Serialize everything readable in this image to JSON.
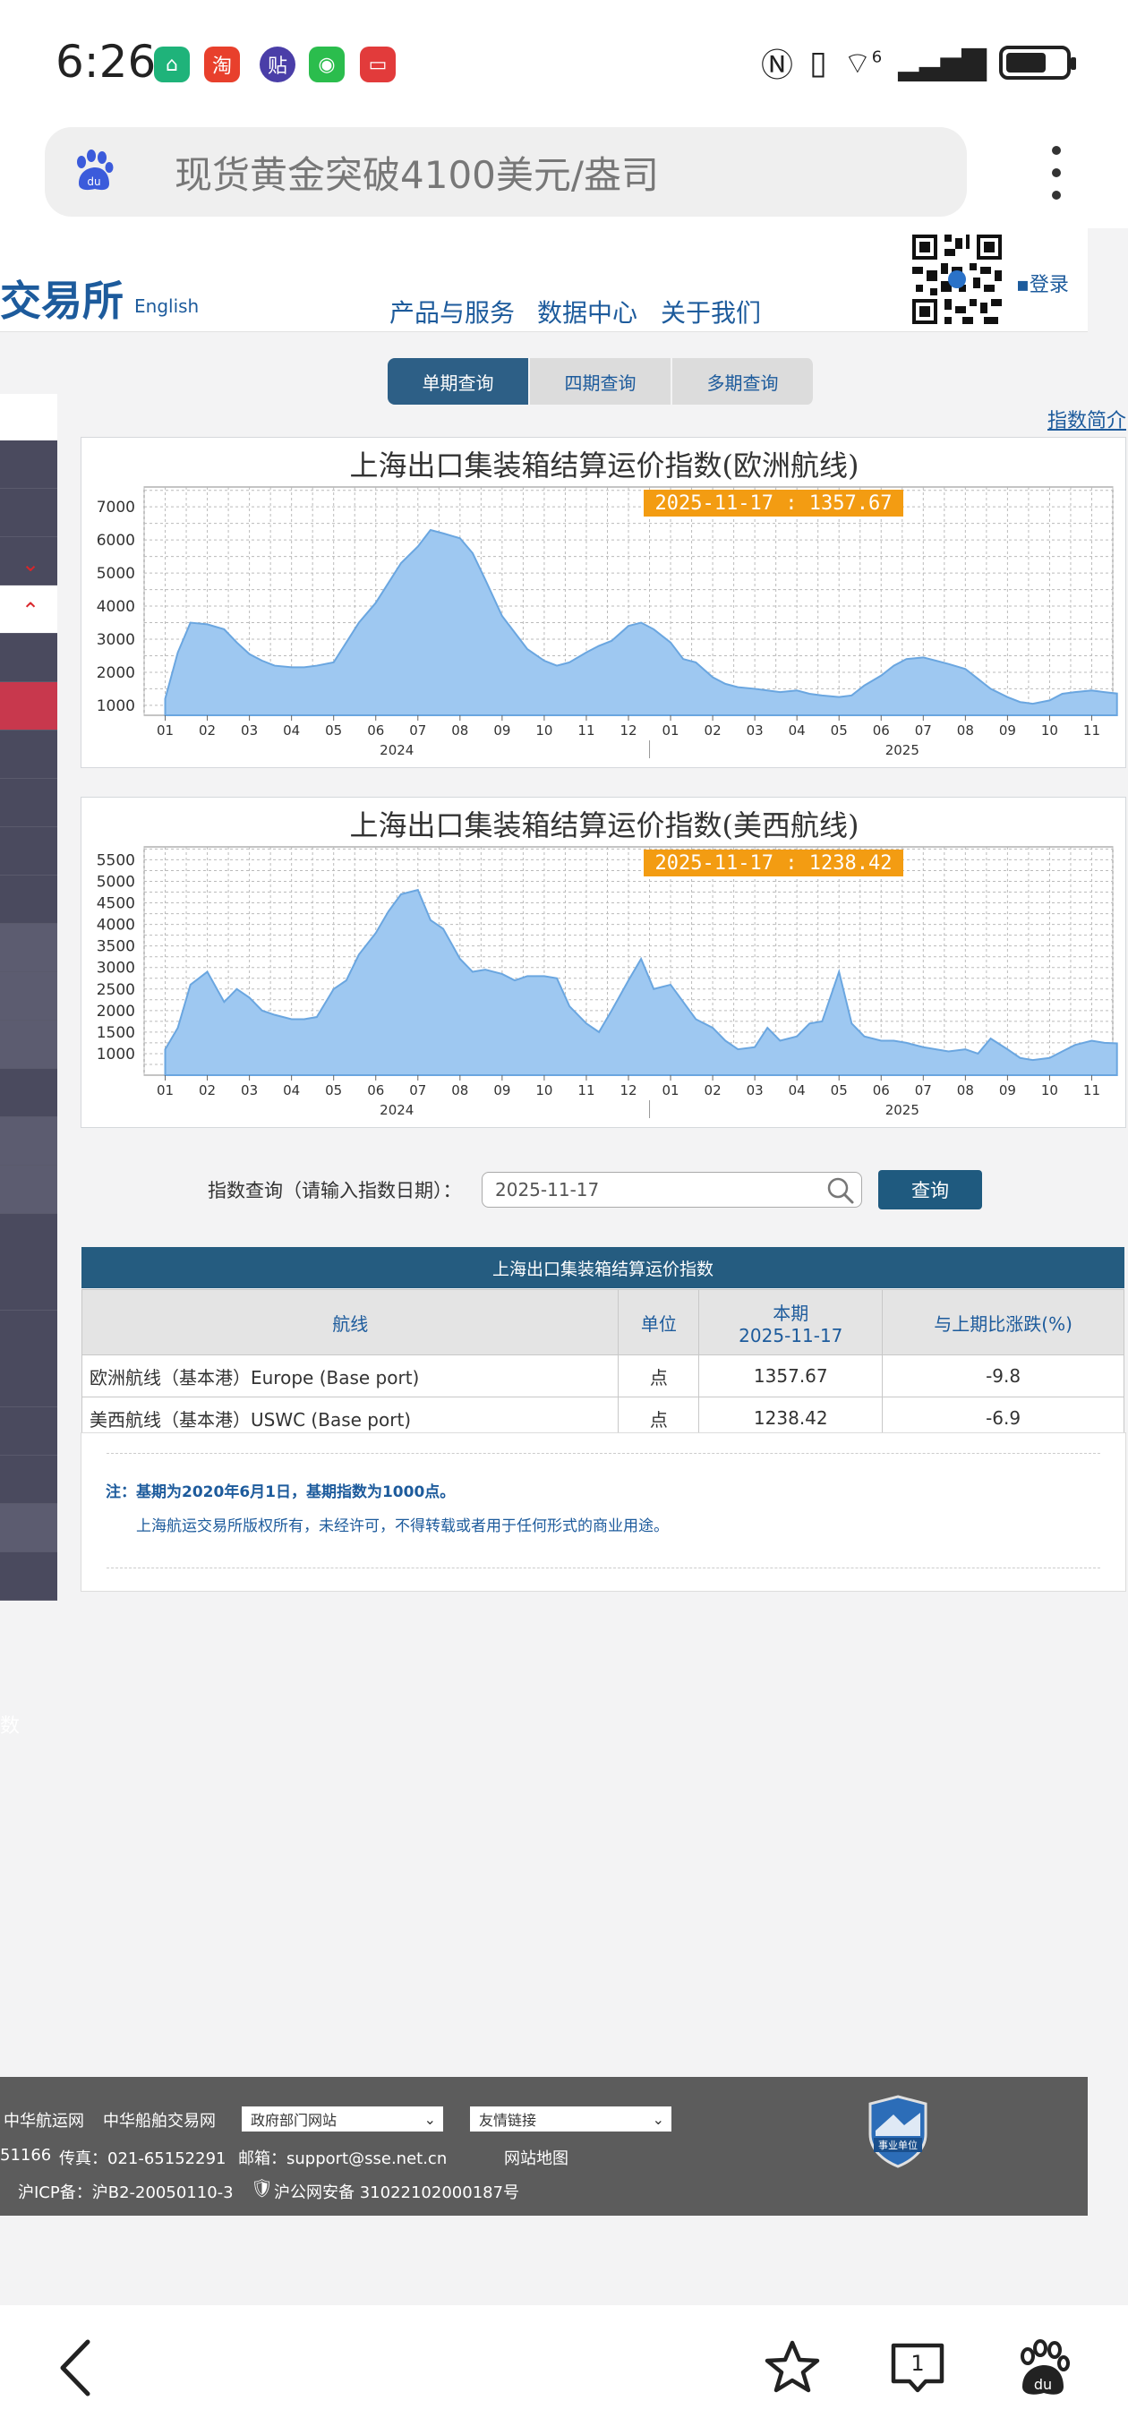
{
  "status": {
    "time": "6:26",
    "network": "6"
  },
  "browser": {
    "address": "现货黄金突破4100美元/盎司"
  },
  "site": {
    "logo_text": "交易所",
    "english": "English",
    "nav": [
      "产品与服务",
      "数据中心",
      "关于我们"
    ],
    "login": "▪登录"
  },
  "tabs": [
    "单期查询",
    "四期查询",
    "多期查询"
  ],
  "intro_link": "指数简介",
  "charts": [
    {
      "title": "上海出口集装箱结算运价指数(欧洲航线)",
      "tooltip": "2025-11-17 : 1357.67"
    },
    {
      "title": "上海出口集装箱结算运价指数(美西航线)",
      "tooltip": "2025-11-17 : 1238.42"
    }
  ],
  "chart_data": [
    {
      "type": "area",
      "title": "上海出口集装箱结算运价指数(欧洲航线)",
      "x_tick_labels": [
        "01",
        "02",
        "03",
        "04",
        "05",
        "06",
        "07",
        "08",
        "09",
        "10",
        "11",
        "12",
        "01",
        "02",
        "03",
        "04",
        "05",
        "06",
        "07",
        "08",
        "09",
        "10",
        "11"
      ],
      "year_labels": [
        "2024",
        "2025"
      ],
      "ylim": [
        700,
        7600
      ],
      "yticks": [
        1000,
        2000,
        3000,
        4000,
        5000,
        6000,
        7000
      ],
      "grid": true,
      "x_month_index": [
        0,
        0.3,
        0.6,
        1,
        1.4,
        1.7,
        2,
        2.3,
        2.6,
        3,
        3.3,
        3.6,
        4,
        4.3,
        4.6,
        5,
        5.3,
        5.6,
        6,
        6.3,
        6.6,
        7,
        7.3,
        7.6,
        8,
        8.3,
        8.6,
        9,
        9.3,
        9.6,
        10,
        10.3,
        10.6,
        11,
        11.3,
        11.6,
        12,
        12.3,
        12.6,
        13,
        13.3,
        13.6,
        14,
        14.3,
        14.6,
        15,
        15.3,
        15.6,
        16,
        16.3,
        16.6,
        17,
        17.3,
        17.6,
        18,
        18.3,
        18.6,
        19,
        19.3,
        19.6,
        20,
        20.3,
        20.6,
        21,
        21.3,
        21.6,
        22,
        22.3,
        22.6
      ],
      "values": [
        1200,
        2600,
        3500,
        3450,
        3300,
        2900,
        2550,
        2350,
        2200,
        2150,
        2150,
        2200,
        2300,
        2900,
        3500,
        4100,
        4700,
        5300,
        5800,
        6300,
        6200,
        6050,
        5600,
        4800,
        3700,
        3200,
        2700,
        2350,
        2200,
        2300,
        2600,
        2800,
        2950,
        3400,
        3500,
        3300,
        2900,
        2400,
        2300,
        1850,
        1650,
        1550,
        1500,
        1450,
        1400,
        1450,
        1350,
        1300,
        1250,
        1300,
        1600,
        1900,
        2200,
        2400,
        2450,
        2350,
        2250,
        2100,
        1800,
        1500,
        1250,
        1100,
        1050,
        1150,
        1350,
        1400,
        1450,
        1400,
        1357.67
      ]
    },
    {
      "type": "area",
      "title": "上海出口集装箱结算运价指数(美西航线)",
      "x_tick_labels": [
        "01",
        "02",
        "03",
        "04",
        "05",
        "06",
        "07",
        "08",
        "09",
        "10",
        "11",
        "12",
        "01",
        "02",
        "03",
        "04",
        "05",
        "06",
        "07",
        "08",
        "09",
        "10",
        "11"
      ],
      "year_labels": [
        "2024",
        "2025"
      ],
      "ylim": [
        500,
        5800
      ],
      "yticks": [
        1000,
        1500,
        2000,
        2500,
        3000,
        3500,
        4000,
        4500,
        5000,
        5500
      ],
      "grid": true,
      "x_month_index": [
        0,
        0.3,
        0.6,
        1,
        1.4,
        1.7,
        2,
        2.3,
        2.6,
        3,
        3.3,
        3.6,
        4,
        4.3,
        4.6,
        5,
        5.3,
        5.6,
        6,
        6.3,
        6.6,
        7,
        7.3,
        7.6,
        8,
        8.3,
        8.6,
        9,
        9.3,
        9.6,
        10,
        10.3,
        10.6,
        11,
        11.3,
        11.6,
        12,
        12.3,
        12.6,
        13,
        13.3,
        13.6,
        14,
        14.3,
        14.6,
        15,
        15.3,
        15.6,
        16,
        16.3,
        16.6,
        17,
        17.3,
        17.6,
        18,
        18.3,
        18.6,
        19,
        19.3,
        19.6,
        20,
        20.3,
        20.6,
        21,
        21.3,
        21.6,
        22,
        22.3,
        22.6
      ],
      "values": [
        1100,
        1600,
        2600,
        2900,
        2200,
        2500,
        2300,
        2000,
        1900,
        1800,
        1800,
        1850,
        2500,
        2700,
        3300,
        3800,
        4300,
        4700,
        4800,
        4100,
        3900,
        3200,
        2900,
        2950,
        2850,
        2700,
        2800,
        2800,
        2750,
        2100,
        1700,
        1500,
        2000,
        2700,
        3200,
        2500,
        2600,
        2200,
        1800,
        1600,
        1300,
        1100,
        1150,
        1600,
        1300,
        1400,
        1700,
        1750,
        2900,
        1700,
        1400,
        1300,
        1300,
        1250,
        1150,
        1100,
        1050,
        1100,
        1000,
        1350,
        1100,
        900,
        850,
        900,
        1050,
        1200,
        1300,
        1250,
        1238.42
      ]
    }
  ],
  "query": {
    "label": "指数查询（请输入指数日期）：",
    "date_value": "2025-11-17",
    "button": "查询"
  },
  "table": {
    "title": "上海出口集装箱结算运价指数",
    "headers": {
      "route": "航线",
      "unit": "单位",
      "current_line1": "本期",
      "current_line2": "2025-11-17",
      "change": "与上期比涨跌(%)"
    },
    "rows": [
      {
        "route": "欧洲航线（基本港）Europe (Base port)",
        "unit": "点",
        "value": "1357.67",
        "change": "-9.8"
      },
      {
        "route": "美西航线（基本港）USWC (Base port)",
        "unit": "点",
        "value": "1238.42",
        "change": "-6.9"
      }
    ]
  },
  "notes": {
    "line1": "注：基期为2020年6月1日，基期指数为1000点。",
    "line2": "上海航运交易所版权所有，未经许可，不得转载或者用于任何形式的商业用途。"
  },
  "footer": {
    "links": [
      "中华航运网",
      "中华船舶交易网"
    ],
    "select_gov": "政府部门网站",
    "select_friend": "友情链接",
    "phone_partial": "51166",
    "fax": "传真：021-65152291",
    "email": "邮箱：support@sse.net.cn",
    "sitemap": "网站地图",
    "icp": "沪ICP备：沪B2-20050110-3",
    "police": "沪公网安备 31022102000187号",
    "badge": "事业单位"
  },
  "sidebar": {
    "partial_text": "数"
  },
  "bottom_nav": {
    "tabs_count": "1"
  },
  "colors": {
    "area_fill": "#9ec8f1",
    "area_stroke": "#6aa6e0",
    "tooltip_bg": "#f39c12",
    "brand_blue": "#1d5b9c",
    "table_head": "#255c80"
  }
}
